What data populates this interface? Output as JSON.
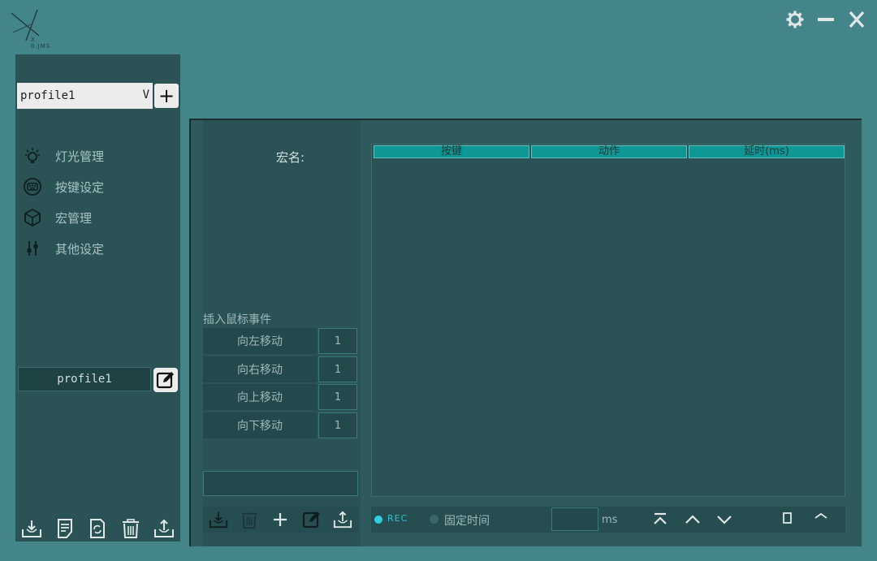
{
  "logo": {
    "text": "X 0.JMS"
  },
  "window_controls": {
    "settings_icon": "gear-icon",
    "minimize_icon": "minus-icon",
    "close_icon": "close-icon"
  },
  "sidebar": {
    "profile_select": {
      "value": "profile1",
      "chevron": "V"
    },
    "add_profile_label": "+",
    "items": [
      {
        "label": "灯光管理",
        "icon": "bulb-icon"
      },
      {
        "label": "按键设定",
        "icon": "keyboard-icon"
      },
      {
        "label": "宏管理",
        "icon": "cube-icon"
      },
      {
        "label": "其他设定",
        "icon": "sliders-icon"
      }
    ],
    "profile_name": "profile1",
    "bottom_icons": [
      "import-icon",
      "document-icon",
      "refresh-icon",
      "trash-icon",
      "export-icon"
    ]
  },
  "macro": {
    "name_label": "宏名:",
    "insert_label": "插入鼠标事件",
    "mouse_events": [
      {
        "label": "向左移动",
        "value": "1"
      },
      {
        "label": "向右移动",
        "value": "1"
      },
      {
        "label": "向上移动",
        "value": "1"
      },
      {
        "label": "向下移动",
        "value": "1"
      }
    ],
    "table_headers": [
      "按键",
      "动作",
      "延时(ms)"
    ],
    "rec_label": "REC",
    "fixed_time_label": "固定时间",
    "ms_label": "ms"
  },
  "colors": {
    "background": "#448589",
    "panel": "#2b5356",
    "accent": "#0e9794",
    "rec": "#30d0e0"
  }
}
